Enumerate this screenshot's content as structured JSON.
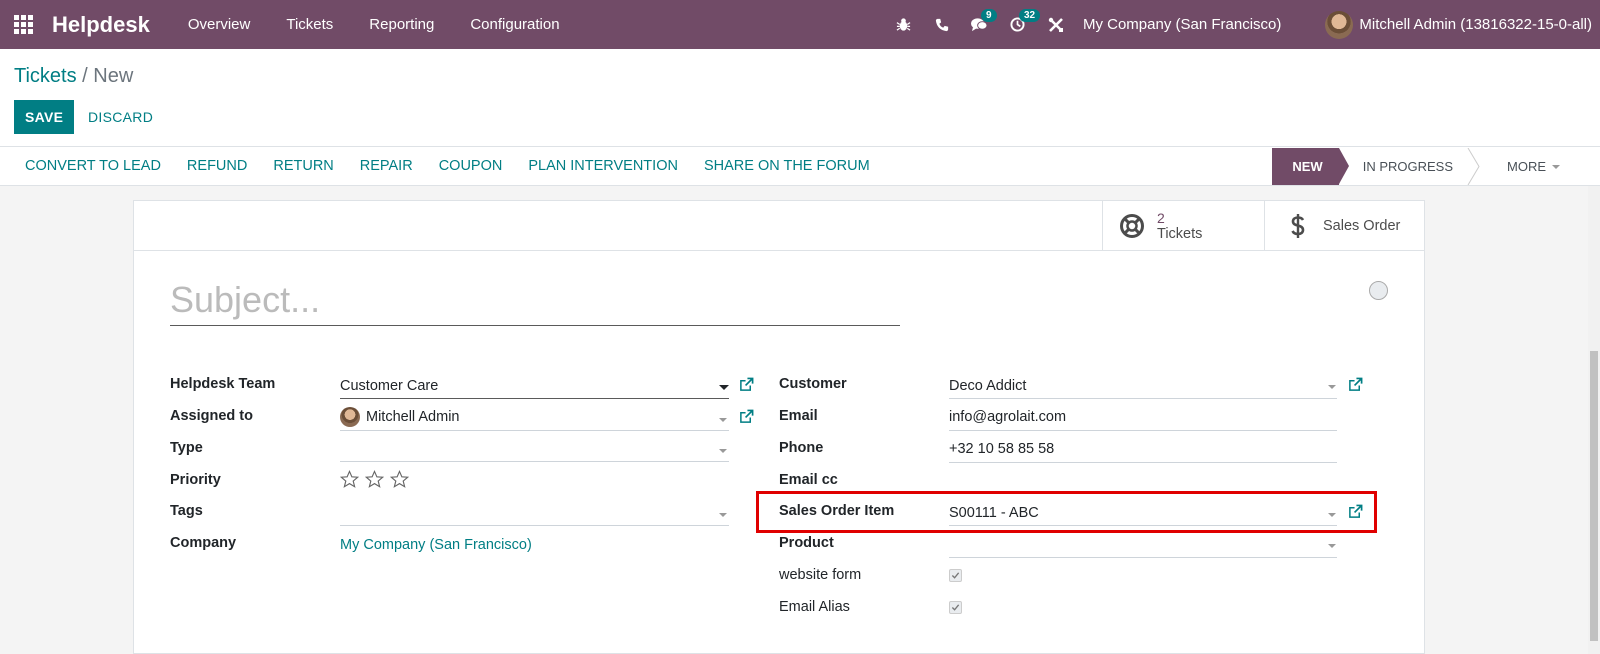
{
  "navbar": {
    "brand": "Helpdesk",
    "menu": [
      "Overview",
      "Tickets",
      "Reporting",
      "Configuration"
    ],
    "messages_badge": "9",
    "activities_badge": "32",
    "company": "My Company (San Francisco)",
    "user": "Mitchell Admin (13816322-15-0-all)"
  },
  "breadcrumb": {
    "parent": "Tickets",
    "separator": "/",
    "current": "New"
  },
  "buttons": {
    "save": "SAVE",
    "discard": "DISCARD"
  },
  "actions": [
    "CONVERT TO LEAD",
    "REFUND",
    "RETURN",
    "REPAIR",
    "COUPON",
    "PLAN INTERVENTION",
    "SHARE ON THE FORUM"
  ],
  "stages": {
    "active": "NEW",
    "next": "IN PROGRESS",
    "more": "MORE"
  },
  "smart_buttons": {
    "tickets_value": "2",
    "tickets_label": "Tickets",
    "sales_label": "Sales Order"
  },
  "form": {
    "subject_placeholder": "Subject...",
    "left": {
      "helpdesk_team_label": "Helpdesk Team",
      "helpdesk_team_value": "Customer Care",
      "assigned_to_label": "Assigned to",
      "assigned_to_value": "Mitchell Admin",
      "type_label": "Type",
      "priority_label": "Priority",
      "tags_label": "Tags",
      "company_label": "Company",
      "company_value": "My Company (San Francisco)"
    },
    "right": {
      "customer_label": "Customer",
      "customer_value": "Deco Addict",
      "email_label": "Email",
      "email_value": "info@agrolait.com",
      "phone_label": "Phone",
      "phone_value": "+32 10 58 85 58",
      "email_cc_label": "Email cc",
      "sales_order_item_label": "Sales Order Item",
      "sales_order_item_value": "S00111 - ABC",
      "product_label": "Product",
      "website_form_label": "website form",
      "email_alias_label": "Email Alias"
    }
  },
  "colors": {
    "brand": "#714b67",
    "accent": "#017e84",
    "highlight": "#e00000"
  },
  "icons": [
    "apps-icon",
    "bug-icon",
    "phone-icon",
    "chat-icon",
    "clock-icon",
    "tools-icon",
    "lifebuoy-icon",
    "dollar-icon",
    "external-link-icon",
    "star-icon",
    "check-icon"
  ]
}
